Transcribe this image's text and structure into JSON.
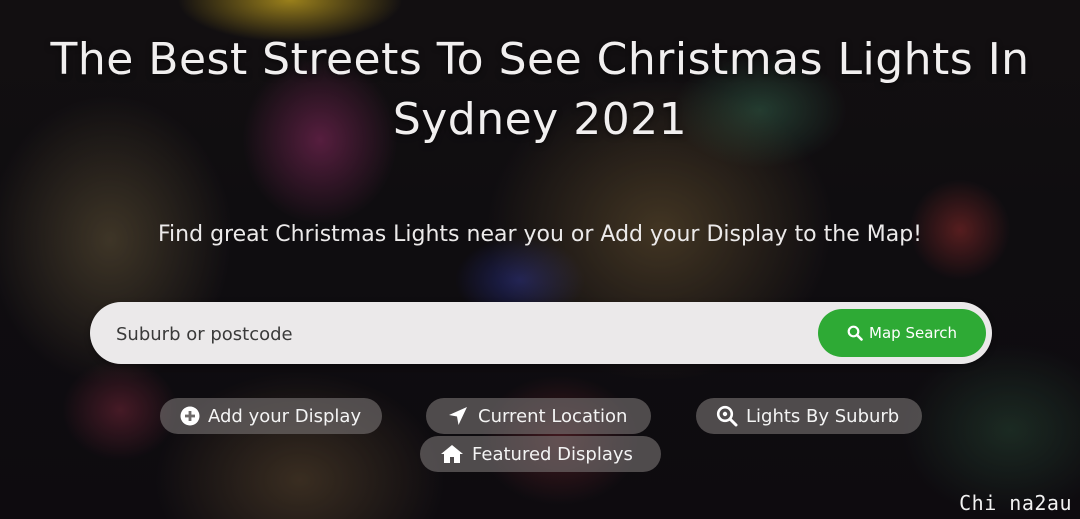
{
  "hero": {
    "title_line1": "The Best Streets To See Christmas Lights In",
    "title_line2": "Sydney 2021",
    "subtitle": "Find great Christmas Lights near you or Add your Display to the Map!"
  },
  "search": {
    "placeholder": "Suburb or postcode",
    "button_label": "Map Search",
    "button_icon": "search-icon",
    "button_color": "#2eaa35"
  },
  "actions": [
    {
      "label": "Add your Display",
      "icon": "plus-circle-icon"
    },
    {
      "label": "Current Location",
      "icon": "location-arrow-icon"
    },
    {
      "label": "Lights By Suburb",
      "icon": "search-location-icon"
    },
    {
      "label": "Featured Displays",
      "icon": "home-icon"
    }
  ],
  "watermark": "Chi na2au"
}
